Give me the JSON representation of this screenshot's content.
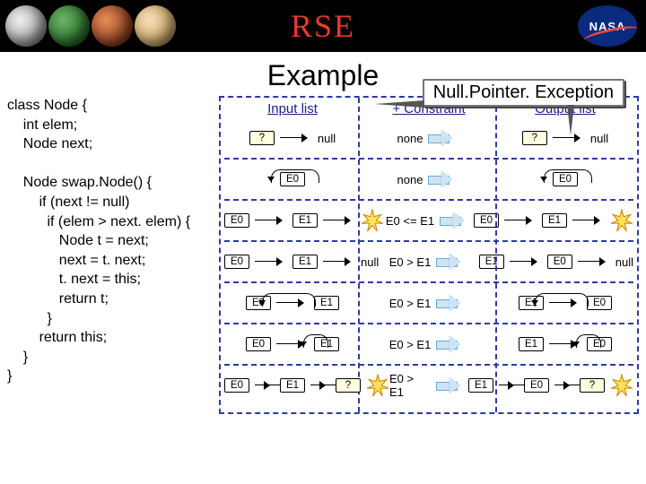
{
  "header": {
    "logo_left": "R",
    "logo_mid": "S",
    "logo_right": "E",
    "nasa": "NASA"
  },
  "title": "Example",
  "callout": "Null.Pointer. Exception",
  "columns": {
    "input": "Input list",
    "constraint": "+ Constraint",
    "output": "Output list"
  },
  "code": "class Node {\n    int elem;\n    Node next;\n\n    Node swap.Node() {\n        if (next != null)\n          if (elem > next. elem) {\n             Node t = next;\n             next = t. next;\n             t. next = this;\n             return t;\n          }\n        return this;\n    }\n}",
  "tokens": {
    "q": "?",
    "null": "null",
    "none": "none",
    "e0": "E0",
    "e1": "E1",
    "c_le": "E0 <= E1",
    "c_gt": "E0 > E1"
  }
}
